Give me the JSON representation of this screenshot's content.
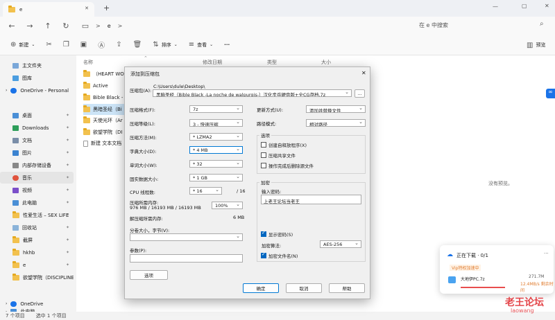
{
  "window": {
    "tab_title": "e",
    "new_tab": "+",
    "close_tab": "✕",
    "min": "—",
    "max": "▢",
    "close": "✕"
  },
  "nav": {
    "path_sep1": ">",
    "path": "e",
    "path_sep2": ">",
    "search_placeholder": "在 e 中搜索"
  },
  "toolbar": {
    "new_label": "新建",
    "sort_label": "排序",
    "view_label": "查看",
    "more": "···",
    "preview_label": "预览"
  },
  "sidebar": {
    "items": [
      {
        "label": "主文件夹",
        "pinned": false
      },
      {
        "label": "图库",
        "pinned": false
      },
      {
        "label": "OneDrive - Personal",
        "pinned": false
      },
      {
        "label": "桌面",
        "pinned": true
      },
      {
        "label": "Downloads",
        "pinned": true
      },
      {
        "label": "文档",
        "pinned": true
      },
      {
        "label": "图片",
        "pinned": true
      },
      {
        "label": "内部存储设备",
        "pinned": true
      },
      {
        "label": "音乐",
        "pinned": true
      },
      {
        "label": "视频",
        "pinned": true
      },
      {
        "label": "此电脑",
        "pinned": true
      },
      {
        "label": "性爱生活 – SEX LIFE",
        "pinned": true
      },
      {
        "label": "回收站",
        "pinned": true
      },
      {
        "label": "截屏",
        "pinned": true
      },
      {
        "label": "hkhb",
        "pinned": true
      },
      {
        "label": "e",
        "pinned": true
      },
      {
        "label": "欲望学院（DISCIPLINE",
        "pinned": true
      },
      {
        "label": "OneDrive",
        "pinned": false
      },
      {
        "label": "此电脑",
        "pinned": false
      }
    ],
    "pin_glyph": "📌"
  },
  "columns": {
    "name": "名称",
    "modified": "修改日期",
    "type": "类型",
    "size": "大小"
  },
  "files": [
    {
      "name": "（HEART WO"
    },
    {
      "name": "Active"
    },
    {
      "name": "Bible Black -"
    },
    {
      "name": "黑暗圣经（Bi"
    },
    {
      "name": "天使光环（Ar"
    },
    {
      "name": "欲望学院（DI"
    },
    {
      "name": "新建 文本文档"
    }
  ],
  "preview_empty": "没有预览。",
  "status": {
    "count": "7 个项目",
    "selected": "选中 1 个项目"
  },
  "dialog": {
    "title": "添加到压缩包",
    "close": "✕",
    "archive_label": "压缩包(A):",
    "archive_dir": "C:\\Users\\dule\\Desktop\\",
    "archive_name": "黑暗圣经（Bible Black -La noche de walpurgis-）汉化步兵硬盘版+全CG存档.7z",
    "browse": "...",
    "format_label": "压缩格式(F):",
    "format_value": "7z",
    "level_label": "压缩等级(L):",
    "level_value": "3 - 快速压缩",
    "method_label": "压缩方法(M):",
    "method_value": "* LZMA2",
    "dict_label": "字典大小(D):",
    "dict_value": "* 4 MB",
    "word_label": "单词大小(W):",
    "word_value": "* 32",
    "solid_label": "固实数据大小:",
    "solid_value": "* 1 GB",
    "threads_label": "CPU 线程数:",
    "threads_value": "* 16",
    "threads_max": "/ 16",
    "mem_label": "压缩所需内存:",
    "mem_value": "976 MB / 16193 MB / 16193 MB",
    "mem_pct": "100%",
    "decomp_label": "解压缩所需内存:",
    "decomp_value": "6 MB",
    "split_label": "分卷大小，字节(V):",
    "params_label": "参数(P):",
    "options_btn": "选项",
    "update_label": "更新方式(U):",
    "update_value": "添加并替换文件",
    "path_label": "路径模式:",
    "path_value": "相对路径",
    "opt_group": "选项",
    "opt1": "创建自释放程序(X)",
    "opt2": "压缩共享文件",
    "opt3": "操作完成后删除源文件",
    "enc_group": "加密",
    "pwd_label": "输入密码:",
    "pwd_value": "上老王论坛当老王",
    "show_pwd": "显示密码(S)",
    "enc_method_label": "加密算法:",
    "enc_method_value": "AES-256",
    "enc_names": "加密文件名(N)",
    "ok": "确定",
    "cancel": "取消",
    "help": "帮助"
  },
  "downloads": {
    "title": "正在下载 · 0/1",
    "vip": "Vip特权加速中",
    "filename": "大地伊PC.7z",
    "size": "271.7M",
    "speed": "12.4MB/s 剩余时间"
  },
  "watermark": {
    "cn": "老王论坛",
    "en": "laowang"
  },
  "colors": {
    "accent": "#0067c0",
    "watermark": "#e0262b",
    "dl_bar": "#e84d4d"
  }
}
